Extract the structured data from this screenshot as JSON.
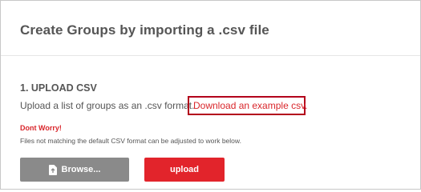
{
  "header": {
    "title": "Create Groups by importing a .csv file"
  },
  "upload_section": {
    "heading": "1. UPLOAD CSV",
    "description": "Upload a list of groups as an .csv format.",
    "example_link": "Download an example csv."
  },
  "warning": {
    "title": "Dont Worry!",
    "text": "Files not matching the default CSV format can be adjusted to work below."
  },
  "buttons": {
    "browse_label": "Browse...",
    "upload_label": "upload"
  },
  "colors": {
    "accent": "#e2242b",
    "link": "#d9262b",
    "highlight_box": "#b3001b",
    "browse_bg": "#8a8a8a",
    "text": "#555555"
  },
  "icons": {
    "browse": "file-upload-icon"
  }
}
